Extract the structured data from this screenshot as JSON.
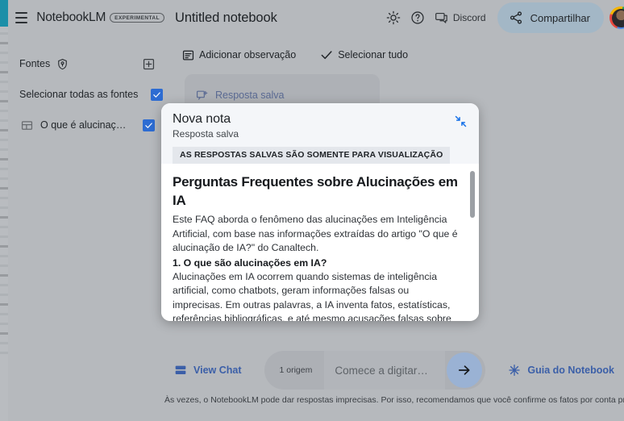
{
  "sidebar": {
    "brand": "NotebookLM",
    "brand_badge": "EXPERIMENTAL",
    "sources_label": "Fontes",
    "select_all_label": "Selecionar todas as fontes",
    "source_item_label": "O que é alucinação d…",
    "checkbox_color": "#2d6cd2"
  },
  "topbar": {
    "notebook_title": "Untitled notebook",
    "discord_label": "Discord",
    "share_label": "Compartilhar",
    "share_bg": "#a3b7c6"
  },
  "content_tools": {
    "add_note_label": "Adicionar observação",
    "select_all_label": "Selecionar tudo"
  },
  "saved_card": {
    "label": "Resposta salva"
  },
  "modal": {
    "title": "Nova nota",
    "subtitle": "Resposta salva",
    "banner": "AS RESPOSTAS SALVAS SÃO SOMENTE PARA VISUALIZAÇÃO",
    "doc_heading": "Perguntas Frequentes sobre Alucinações em IA",
    "paragraph_1": "Este FAQ aborda o fenômeno das alucinações em Inteligência Artificial, com base nas informações extraídas do artigo \"O que é alucinação de IA?\" do Canaltech.",
    "question_1": "1. O que são alucinações em IA?",
    "answer_1": "Alucinações em IA ocorrem quando sistemas de inteligência artificial, como chatbots, geram informações falsas ou imprecisas. Em outras palavras, a IA inventa fatos, estatísticas, referências bibliográficas, e até mesmo acusações falsas sobre pessoas, mesmo sem ter a intenção de enganar."
  },
  "bottombar": {
    "view_chat_label": "View Chat",
    "origem_chip": "1 origem",
    "composer_placeholder": "Comece a digitar…",
    "guide_label": "Guia do Notebook",
    "disclaimer": "Às vezes, o NotebookLM pode dar respostas imprecisas. Por isso, recomendamos que você confirme os fatos por conta própria.",
    "link_color": "#3b5fa8"
  }
}
